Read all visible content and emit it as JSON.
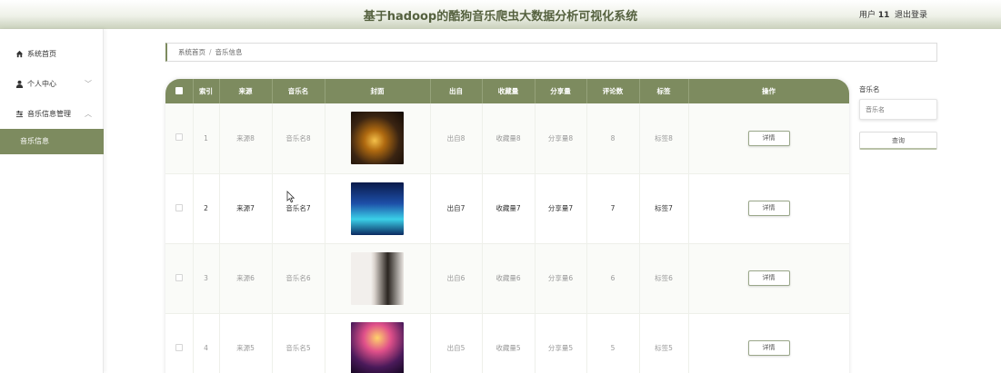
{
  "header": {
    "title": "基于hadoop的酷狗音乐爬虫大数据分析可视化系统",
    "user_prefix": "用户",
    "user_id": "11",
    "logout_label": "退出登录"
  },
  "sidebar": {
    "items": [
      {
        "label": "系统首页",
        "icon": "home-icon"
      },
      {
        "label": "个人中心",
        "icon": "user-icon",
        "chevron": "﹀"
      },
      {
        "label": "音乐信息管理",
        "icon": "settings-icon",
        "chevron": "︿"
      },
      {
        "label": "音乐信息",
        "active": true
      }
    ]
  },
  "breadcrumb": {
    "home": "系统首页",
    "separator": "/",
    "current": "音乐信息"
  },
  "table": {
    "headers": [
      "索引",
      "来源",
      "音乐名",
      "封面",
      "出自",
      "收藏量",
      "分享量",
      "评论数",
      "标签",
      "操作"
    ],
    "action_label": "详情",
    "rows": [
      {
        "index": "1",
        "source": "来源8",
        "name": "音乐名8",
        "origin": "出自8",
        "favorites": "收藏量8",
        "shares": "分享量8",
        "comments": "8",
        "tag": "标签8",
        "cover_color": "#3a2412"
      },
      {
        "index": "2",
        "source": "来源7",
        "name": "音乐名7",
        "origin": "出自7",
        "favorites": "收藏量7",
        "shares": "分享量7",
        "comments": "7",
        "tag": "标签7",
        "cover_color": "#12306a"
      },
      {
        "index": "3",
        "source": "来源6",
        "name": "音乐名6",
        "origin": "出自6",
        "favorites": "收藏量6",
        "shares": "分享量6",
        "comments": "6",
        "tag": "标签6",
        "cover_color": "#d8d4d0"
      },
      {
        "index": "4",
        "source": "来源5",
        "name": "音乐名5",
        "origin": "出自5",
        "favorites": "收藏量5",
        "shares": "分享量5",
        "comments": "5",
        "tag": "标签5",
        "cover_color": "#4a1a5a"
      }
    ]
  },
  "filter": {
    "label": "音乐名",
    "placeholder": "音乐名",
    "search_label": "查询"
  },
  "colors": {
    "accent": "#7d8b5f",
    "header_title": "#55613f"
  }
}
